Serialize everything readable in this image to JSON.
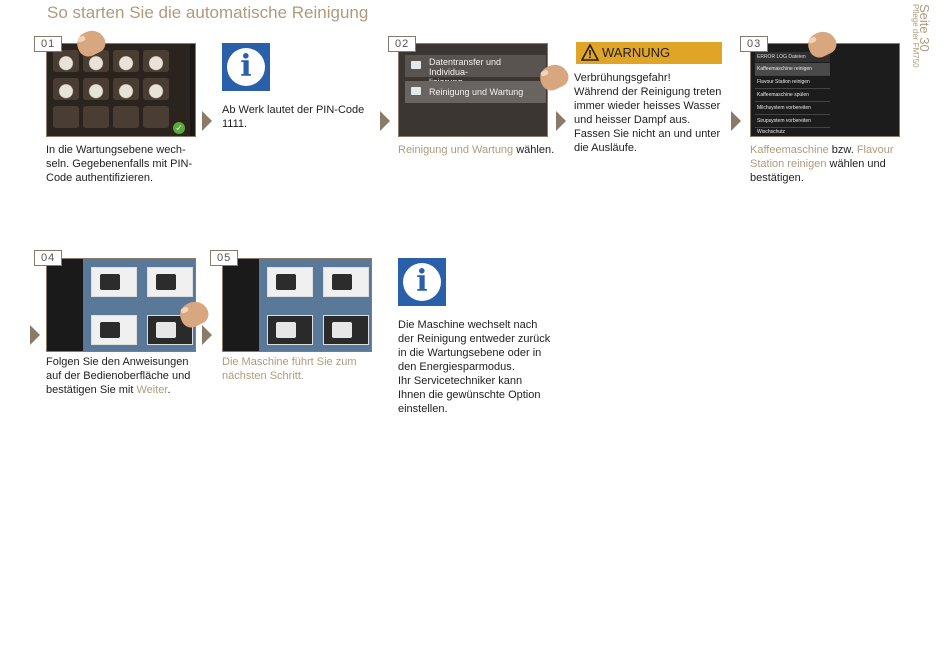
{
  "header": {
    "title": "So starten Sie die automatische Reinigung"
  },
  "side": {
    "page": "Seite 30",
    "sub": "Pflege der FM750"
  },
  "steps": {
    "s01": {
      "num": "01",
      "text": "In die Wartungsebene wech-\nseln. Gegebenenfalls mit PIN-\nCode authentifizieren."
    },
    "info1": {
      "text": "Ab Werk lautet der PIN-Code\n1111.",
      "icon": "info-icon"
    },
    "s02": {
      "num": "02",
      "menu_item_1": "Datentransfer und Individua-\nlisierung",
      "menu_item_2": "Reinigung und Wartung",
      "text_highlight": "Reinigung und Wartung",
      "text_rest": " wählen."
    },
    "warning": {
      "label": "WARNUNG",
      "text": "Verbrühungsgefahr!\nWährend der Reinigung treten\nimmer wieder heisses Wasser\nund heisser Dampf aus.\nFassen Sie nicht an und unter\ndie Ausläufe.",
      "color": "#e0a426"
    },
    "s03": {
      "num": "03",
      "list_header": "ERROR LOG Dateien",
      "list": [
        "Kaffeemaschine reinigen",
        "Flavour Station reinigen",
        "Kaffeemaschine spülen",
        "Milchsystem vorbereiten",
        "Sirupsystem vorbereiten",
        "Wischschutz"
      ],
      "text_h1": "Kaffeemaschine",
      "text_mid": " bzw. ",
      "text_h2": "Flavour\nStation reinigen",
      "text_rest": " wählen und\nbestätigen."
    },
    "s04": {
      "num": "04",
      "text": "Folgen Sie den Anweisungen\nauf der Bedienoberfläche und\nbestätigen Sie mit ",
      "text_highlight": "Weiter",
      "text_end": "."
    },
    "s05": {
      "num": "05",
      "text": "Die Maschine führt Sie zum\nnächsten Schritt."
    },
    "info2": {
      "text": "Die Maschine wechselt nach\nder Reinigung entweder zurück\nin die Wartungsebene oder in\nden Energiesparmodus.\nIhr Servicetechniker kann\nIhnen die gewünschte Option\neinstellen.",
      "icon": "info-icon"
    }
  },
  "colors": {
    "accent": "#b09a7d",
    "info_blue": "#2a5faa",
    "frame": "#8a7a68"
  }
}
